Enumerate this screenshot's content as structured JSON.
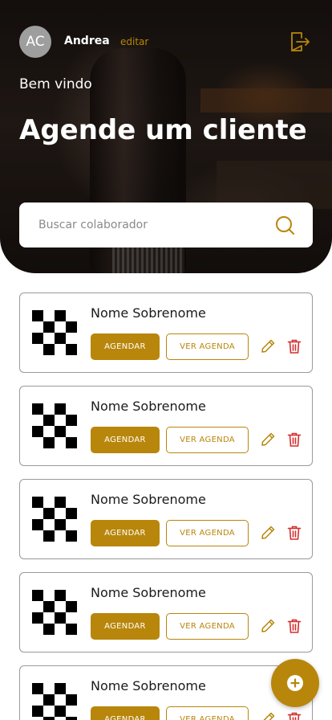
{
  "header": {
    "avatar_initials": "AC",
    "username": "Andrea",
    "edit_label": "editar",
    "logout_icon": "logout-icon",
    "welcome": "Bem vindo",
    "headline": "Agende um cliente"
  },
  "search": {
    "placeholder": "Buscar colaborador",
    "icon": "search-icon"
  },
  "list": {
    "items": [
      {
        "name": "Nome Sobrenome",
        "schedule_label": "AGENDAR",
        "view_label": "VER AGENDA"
      },
      {
        "name": "Nome Sobrenome",
        "schedule_label": "AGENDAR",
        "view_label": "VER AGENDA"
      },
      {
        "name": "Nome Sobrenome",
        "schedule_label": "AGENDAR",
        "view_label": "VER AGENDA"
      },
      {
        "name": "Nome Sobrenome",
        "schedule_label": "AGENDAR",
        "view_label": "VER AGENDA"
      },
      {
        "name": "Nome Sobrenome",
        "schedule_label": "AGENDAR",
        "view_label": "VER AGENDA"
      }
    ]
  },
  "fab": {
    "icon": "plus-icon"
  },
  "colors": {
    "accent": "#b8860b",
    "delete": "#d32f2f",
    "avatar_bg": "#9e9e9e"
  }
}
